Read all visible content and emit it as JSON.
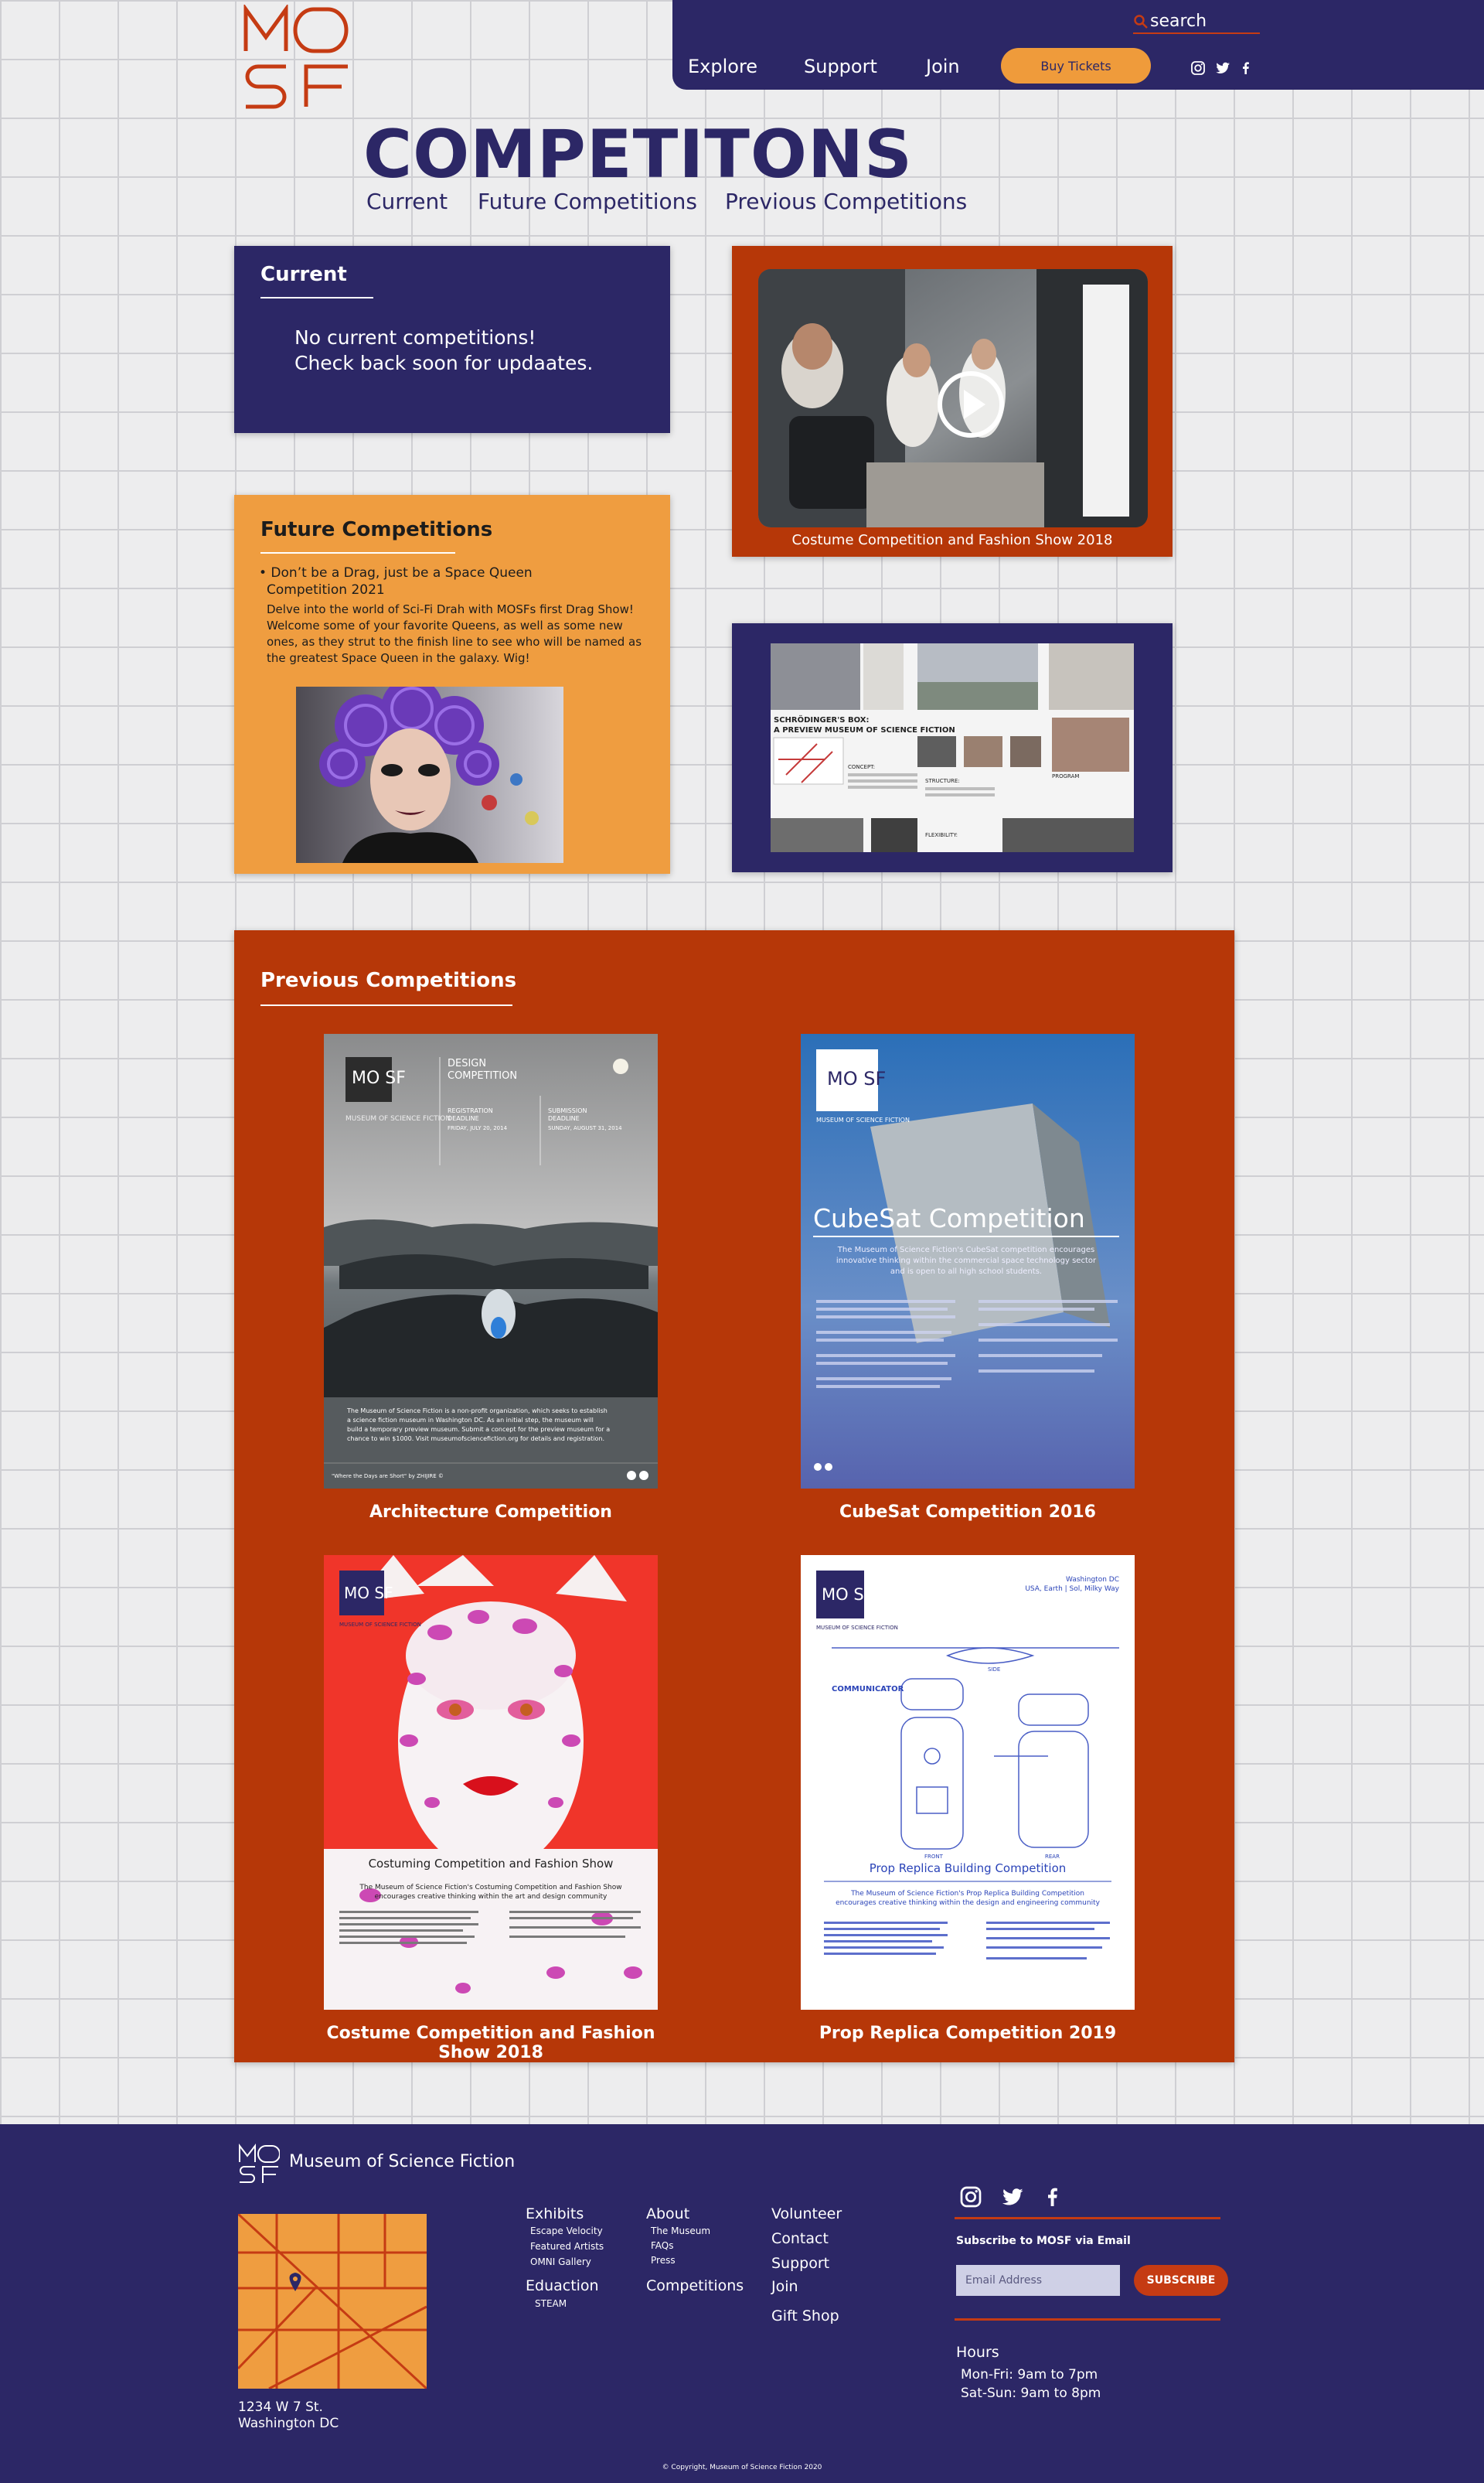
{
  "brand": {
    "logo_alt": "MOSF",
    "name": "Museum of Science Fiction",
    "colors": {
      "navy": "#2c2766",
      "orange": "#ef9d40",
      "rust": "#b63708",
      "accent": "#c53b13"
    }
  },
  "header": {
    "search_placeholder": "search",
    "nav": [
      "Explore",
      "Support",
      "Join"
    ],
    "buy_tickets": "Buy Tickets",
    "social_icons": [
      "instagram-icon",
      "twitter-icon",
      "facebook-icon"
    ]
  },
  "page": {
    "title": "COMPETITONS",
    "subnav": [
      "Current",
      "Future Competitions",
      "Previous Competitions"
    ]
  },
  "current": {
    "heading": "Current",
    "message_line1": "No current competitions!",
    "message_line2": "Check back soon for updaates."
  },
  "video": {
    "caption": "Costume Competition and Fashion Show 2018"
  },
  "future": {
    "heading": "Future Competitions",
    "item_title_line1": "• Don’t be a Drag, just be a Space Queen",
    "item_title_line2": "Competition 2021",
    "description_lines": [
      "Delve into the world of Sci-Fi Drah with MOSFs first Drag Show!",
      "Welcome some of your favorite Queens, as well as some new",
      "ones, as they strut to the finish line to see who will be named as",
      "the greatest Space Queen in the galaxy. Wig!"
    ]
  },
  "preview_board": {
    "title_line1": "SCHRÖDINGER'S BOX:",
    "title_line2": "A PREVIEW MUSEUM OF SCIENCE FICTION",
    "labels": [
      "CONCEPT:",
      "STRUCTURE:",
      "PROGRAM",
      "FLEXIBILITY:"
    ]
  },
  "previous": {
    "heading": "Previous Competitions",
    "items": [
      {
        "caption": "Architecture Competition",
        "poster": {
          "logo": "MO SF",
          "logo_sub": "MUSEUM OF SCIENCE FICTION",
          "headline_line1": "DESIGN",
          "headline_line2": "COMPETITION",
          "col1_line1": "REGISTRATION",
          "col1_line2": "DEADLINE",
          "col1_date": "FRIDAY, JULY 20, 2014",
          "col2_line1": "SUBMISSION",
          "col2_line2": "DEADLINE",
          "col2_date": "SUNDAY, AUGUST 31, 2014",
          "body_line1": "The Museum of Science Fiction is a non-profit organization, which seeks to establish",
          "body_line2": "a science fiction museum in Washington DC. As an initial step, the museum will",
          "body_line3": "build a temporary preview museum. Submit a concept for the preview museum for a",
          "body_line4": "chance to win $1000. Visit museumofsciencefiction.org for details and registration.",
          "footer_quote": "\"Where the Days are Short\" by ZHIJIRE ©"
        }
      },
      {
        "caption": "CubeSat Competition 2016",
        "poster": {
          "logo": "MO SF",
          "logo_sub": "MUSEUM OF SCIENCE FICTION",
          "headline": "CubeSat Competition",
          "intro_line1": "The Museum of Science Fiction's CubeSat competition encourages",
          "intro_line2": "innovative thinking within the commercial space technology sector",
          "intro_line3": "and is open to all high school students."
        }
      },
      {
        "caption": "Costume Competition and Fashion Show 2018",
        "poster": {
          "logo": "MO SF",
          "logo_sub": "MUSEUM OF SCIENCE FICTION",
          "headline": "Costuming Competition and Fashion Show",
          "intro_line1": "The Museum of Science Fiction's Costuming Competition and Fashion Show",
          "intro_line2": "encourages creative thinking within the art and design community"
        }
      },
      {
        "caption": "Prop Replica Competition 2019",
        "poster": {
          "logo": "MO SF",
          "logo_sub": "MUSEUM OF SCIENCE FICTION",
          "corner_line1": "Washington DC",
          "corner_line2": "USA, Earth | Sol, Milky Way",
          "headline": "Prop Replica Building Competition",
          "intro_line1": "The Museum of Science Fiction's Prop Replica Building Competition",
          "intro_line2": "encourages creative thinking within the design and engineering community",
          "device_title": "COMMUNICATOR",
          "label_front": "FRONT",
          "label_rear": "REAR",
          "label_side": "SIDE"
        }
      }
    ]
  },
  "footer": {
    "logo": "MO SF",
    "museum_name": "Museum of Science Fiction",
    "address_line1": "1234 W 7 St.",
    "address_line2": "Washington DC",
    "columns": {
      "exhibits": {
        "title": "Exhibits",
        "links": [
          "Escape Velocity",
          "Featured Artists",
          "OMNI Gallery"
        ]
      },
      "about": {
        "title": "About",
        "links": [
          "The Museum",
          "FAQs",
          "Press"
        ]
      },
      "education": {
        "title": "Eduaction",
        "links": [
          "STEAM"
        ]
      },
      "competitions": {
        "title": "Competitions"
      },
      "misc": [
        "Volunteer",
        "Contact",
        "Support",
        "Join",
        "Gift Shop"
      ]
    },
    "subscribe_label": "Subscribe to MOSF via Email",
    "email_placeholder": "Email Address",
    "subscribe_button": "SUBSCRIBE",
    "hours_title": "Hours",
    "hours_line1": "Mon-Fri: 9am to 7pm",
    "hours_line2": "Sat-Sun: 9am to 8pm",
    "copyright": "© Copyright, Museum of Science Fiction 2020"
  }
}
